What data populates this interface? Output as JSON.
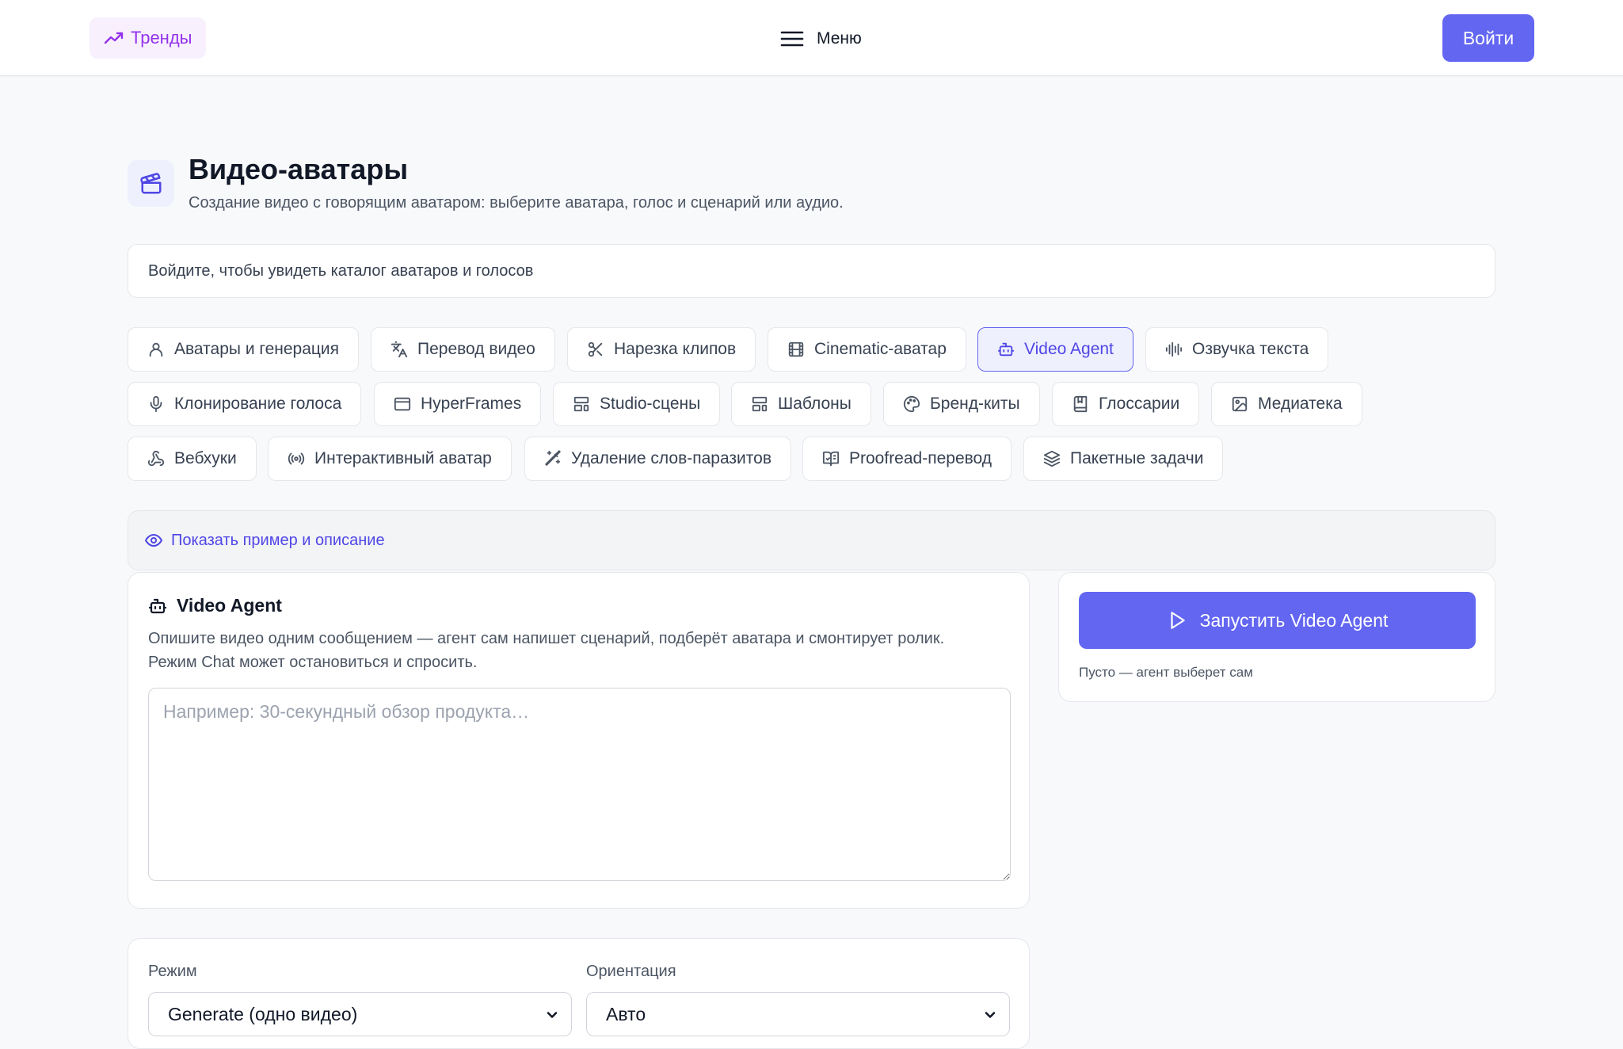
{
  "topbar": {
    "trends_label": "Тренды",
    "menu_label": "Меню",
    "login_label": "Войти"
  },
  "header": {
    "title": "Видео-аватары",
    "subtitle": "Создание видео с говорящим аватаром: выберите аватара, голос и сценарий или аудио."
  },
  "login_banner": {
    "text": "Войдите, чтобы увидеть каталог аватаров и голосов"
  },
  "tabs": [
    {
      "label": "Аватары и генерация",
      "icon": "user-icon"
    },
    {
      "label": "Перевод видео",
      "icon": "translate-icon"
    },
    {
      "label": "Нарезка клипов",
      "icon": "scissors-icon"
    },
    {
      "label": "Cinematic-аватар",
      "icon": "film-icon"
    },
    {
      "label": "Video Agent",
      "icon": "bot-icon",
      "active": true
    },
    {
      "label": "Озвучка текста",
      "icon": "audio-waveform-icon"
    },
    {
      "label": "Клонирование голоса",
      "icon": "microphone-icon"
    },
    {
      "label": "HyperFrames",
      "icon": "browser-window-icon"
    },
    {
      "label": "Studio-сцены",
      "icon": "layout-icon"
    },
    {
      "label": "Шаблоны",
      "icon": "template-icon"
    },
    {
      "label": "Бренд-киты",
      "icon": "palette-icon"
    },
    {
      "label": "Глоссарии",
      "icon": "book-icon"
    },
    {
      "label": "Медиатека",
      "icon": "image-icon"
    },
    {
      "label": "Вебхуки",
      "icon": "webhook-icon"
    },
    {
      "label": "Интерактивный аватар",
      "icon": "radio-broadcast-icon"
    },
    {
      "label": "Удаление слов-паразитов",
      "icon": "magic-wand-icon"
    },
    {
      "label": "Proofread-перевод",
      "icon": "book-check-icon"
    },
    {
      "label": "Пакетные задачи",
      "icon": "layers-icon"
    }
  ],
  "example_toggle": {
    "label": "Показать пример и описание"
  },
  "agent_card": {
    "title": "Video Agent",
    "description_line1": "Опишите видео одним сообщением — агент сам напишет сценарий, подберёт аватара и смонтирует ролик.",
    "description_line2": "Режим Chat может остановиться и спросить.",
    "prompt_placeholder": "Например: 30-секундный обзор продукта…",
    "prompt_value": ""
  },
  "run_card": {
    "button_label": "Запустить Video Agent",
    "hint": "Пусто — агент выберет сам"
  },
  "settings": {
    "mode_label": "Режим",
    "mode_value": "Generate (одно видео)",
    "orientation_label": "Ориентация",
    "orientation_value": "Авто"
  },
  "colors": {
    "accent": "#6366f1",
    "accent_text": "#4f46e5",
    "trends": "#9333ea",
    "trends_bg": "#f9f0fe",
    "page_bg": "#f8f9fb",
    "border": "#e5e7eb"
  }
}
